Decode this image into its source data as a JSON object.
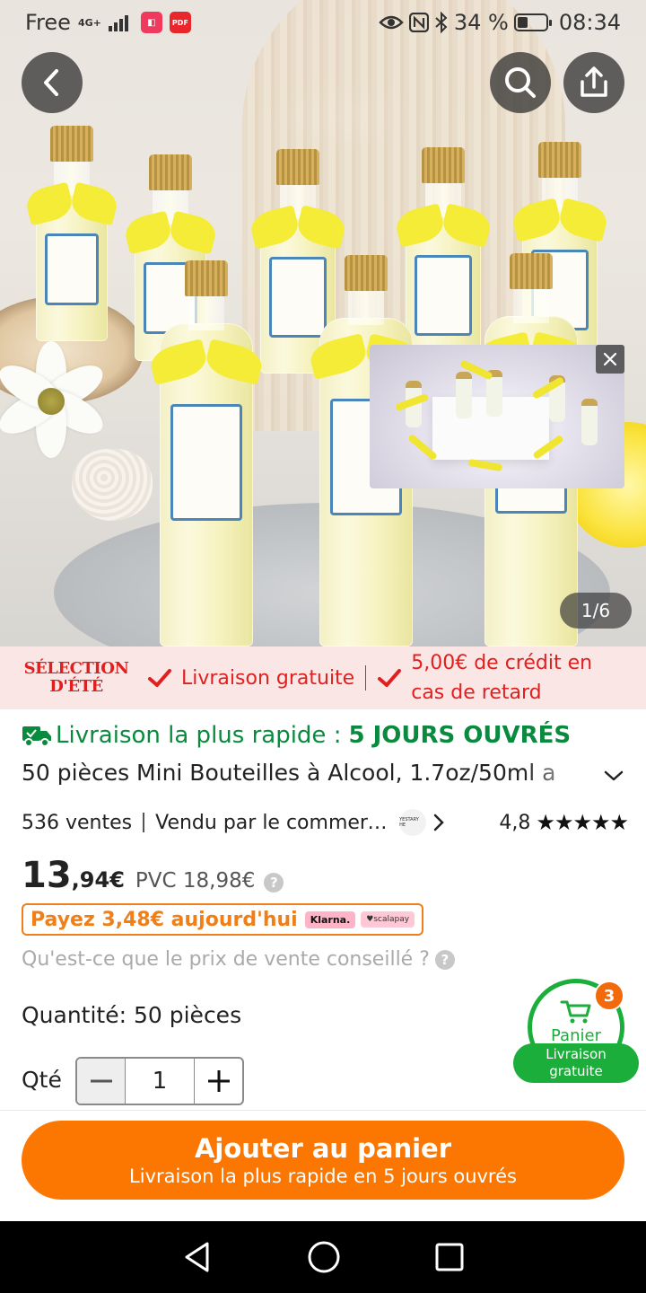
{
  "status_bar": {
    "carrier": "Free",
    "network": "4G+",
    "battery": "34 %",
    "battery_level": 0.34,
    "time": "08:34"
  },
  "gallery": {
    "counter": "1/6",
    "back_icon": "chevron-left-icon",
    "search_icon": "search-icon",
    "share_icon": "share-icon",
    "video_close_icon": "close-icon"
  },
  "promo": {
    "badge_line1": "SÉLECTION",
    "badge_line2": "D'ÉTÉ",
    "free_delivery": "Livraison gratuite",
    "credit_line": "5,00€ de crédit en cas de retard",
    "color": "#e0201f"
  },
  "product": {
    "delivery_label": "Livraison la plus rapide :",
    "delivery_value": "5 JOURS OUVRÉS",
    "title": "50 pièces Mini Bouteilles à Alcool, 1.7oz/50ml a",
    "sales": "536 ventes",
    "seller": "Vendu par le commerç…",
    "seller_logo": "YESTARY HE",
    "rating": "4,8",
    "stars": "★★★★★",
    "price_int": "13",
    "price_dec": ",94€",
    "rrp": "PVC 18,98€",
    "installment": "Payez 3,48€ aujourd'hui",
    "klarna": "Klarna.",
    "scalapay": "♥scalapay",
    "rrp_question": "Qu'est-ce que le prix de vente conseillé ?",
    "quantity_label": "Quantité: 50 pièces",
    "qty_label": "Qté",
    "qty_value": "1"
  },
  "cart": {
    "label": "Panier",
    "count": "3",
    "banner_line1": "Livraison",
    "banner_line2": "gratuite",
    "color": "#1cae3b"
  },
  "cta": {
    "main": "Ajouter au panier",
    "sub": "Livraison la plus rapide en 5 jours ouvrés",
    "color": "#fb7701"
  }
}
